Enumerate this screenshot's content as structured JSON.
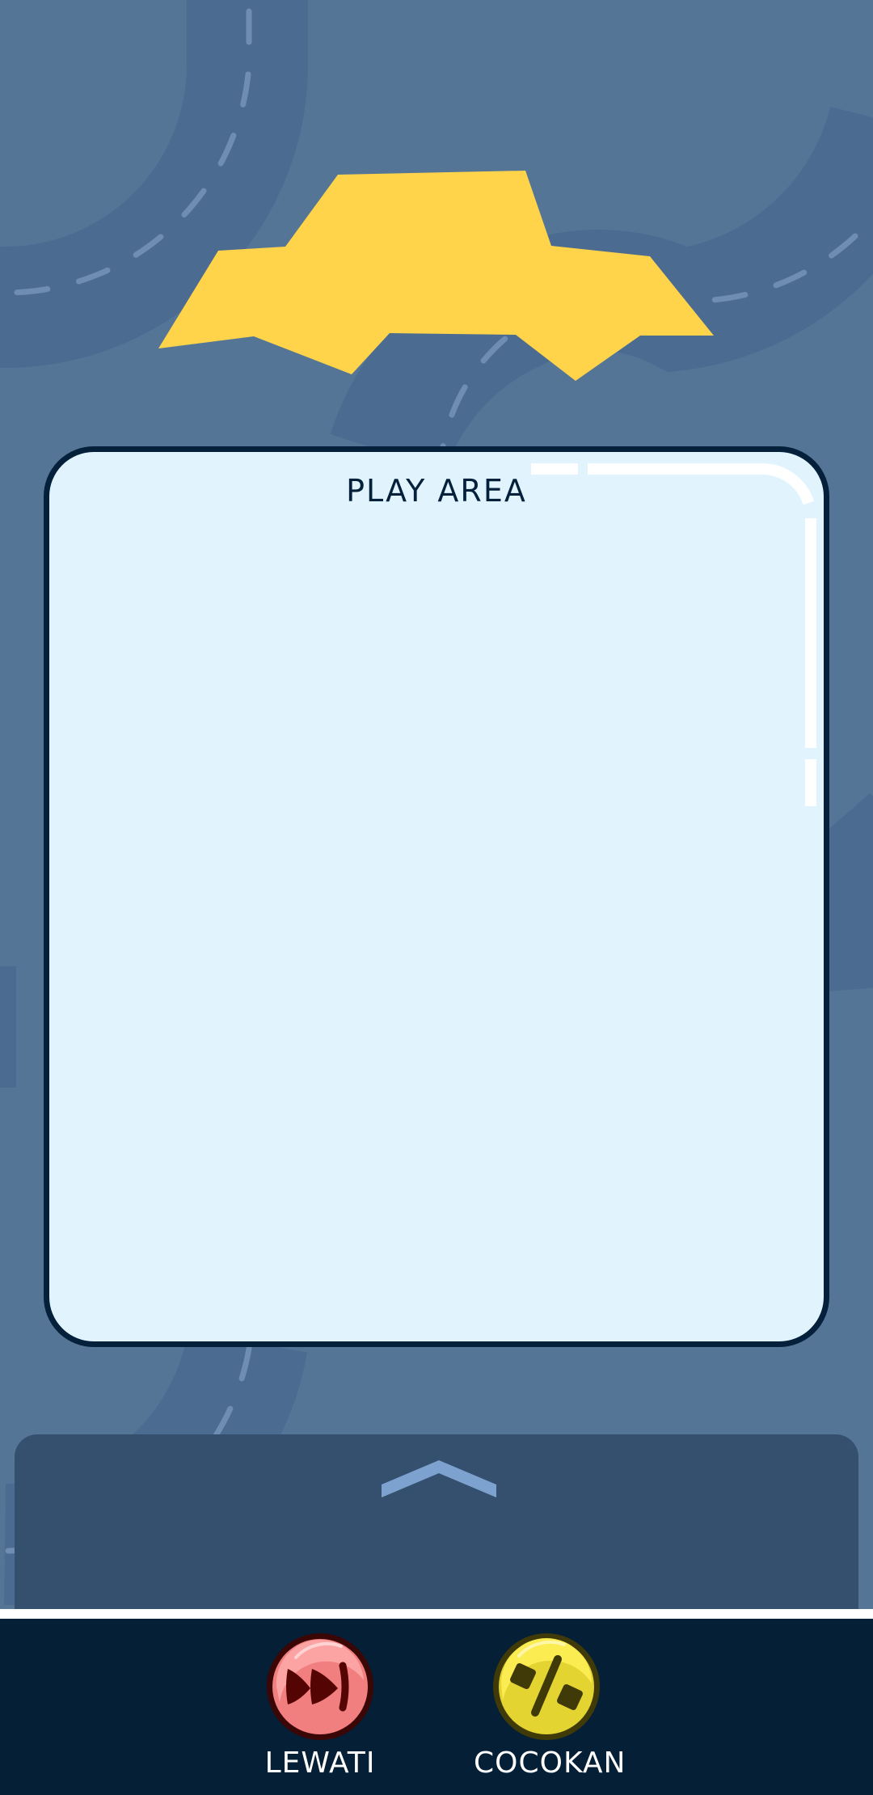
{
  "play_area": {
    "label": "PLAY AREA"
  },
  "drawer": {
    "toggle_icon": "chevron-up-icon"
  },
  "actions": {
    "skip": {
      "label": "LEWATI",
      "icon": "fast-forward-icon",
      "color": "#f68585"
    },
    "match": {
      "label": "COCOKAN",
      "icon": "percent-icon",
      "color": "#f5e135"
    }
  },
  "colors": {
    "background": "#557596",
    "road": "#4b6b91",
    "puzzle_piece": "#ffd34a",
    "card_fill": "#e1f4fd",
    "card_border": "#04203a",
    "bottom_bar": "#041f36"
  }
}
